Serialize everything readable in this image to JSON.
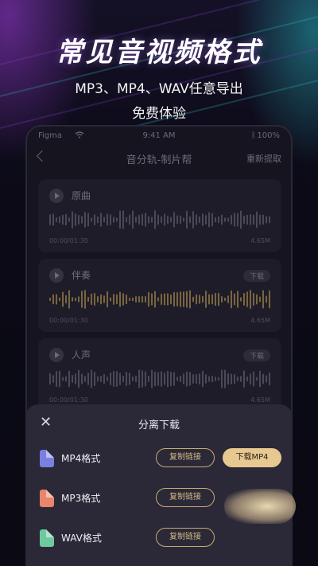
{
  "hero": {
    "title": "常见音视频格式",
    "subtitle_line1": "MP3、MP4、WAV任意导出",
    "subtitle_line2": "免费体验"
  },
  "status_bar": {
    "carrier": "Figma",
    "time": "9:41 AM",
    "battery": "100%"
  },
  "nav": {
    "title": "音分轨-制片帮",
    "action": "重新提取"
  },
  "tracks": [
    {
      "name": "原曲",
      "time": "00:00/01:30",
      "size": "4.65M",
      "download": "",
      "wave_color": "#4a4957"
    },
    {
      "name": "伴奏",
      "time": "00:00/01:30",
      "size": "4.65M",
      "download": "下载",
      "wave_color": "#7a6540"
    },
    {
      "name": "人声",
      "time": "00:00/01:30",
      "size": "4.65M",
      "download": "下载",
      "wave_color": "#4a4957"
    }
  ],
  "sheet": {
    "close": "✕",
    "title": "分离下载",
    "formats": [
      {
        "label": "MP4格式",
        "copy": "复制链接",
        "download": "下载MP4",
        "icon": "video-file-icon",
        "icon_color": "#7a7fe0"
      },
      {
        "label": "MP3格式",
        "copy": "复制链接",
        "download": "",
        "icon": "music-file-icon",
        "icon_color": "#e8856a"
      },
      {
        "label": "WAV格式",
        "copy": "复制链接",
        "download": "",
        "icon": "wav-file-icon",
        "icon_color": "#6fc9a0"
      }
    ]
  },
  "colors": {
    "accent_gold": "#e6c890",
    "background": "#0b0a16"
  }
}
